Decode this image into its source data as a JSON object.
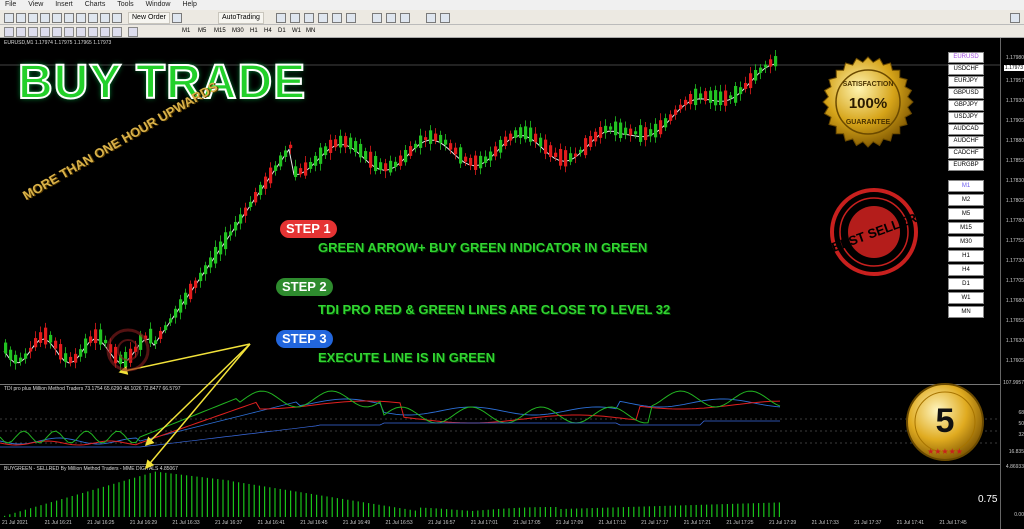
{
  "menu": [
    "File",
    "View",
    "Insert",
    "Charts",
    "Tools",
    "Window",
    "Help"
  ],
  "toolbar": {
    "new_order": "New Order",
    "autotrading": "AutoTrading"
  },
  "timeframes": [
    "M1",
    "M5",
    "M15",
    "M30",
    "H1",
    "H4",
    "D1",
    "W1",
    "MN"
  ],
  "chart": {
    "title": "EURUSD,M1  1.17974 1.17975 1.17965 1.17973",
    "price_labels": [
      "1.17980",
      "1.17973",
      "1.17957",
      "1.17930",
      "1.17905",
      "1.17880",
      "1.17855",
      "1.17830",
      "1.17805",
      "1.17780",
      "1.17755",
      "1.17730",
      "1.17705",
      "1.17680",
      "1.17655",
      "1.17630",
      "1.17605"
    ],
    "tdi_title": "TDI pro plus Million Method Traders 73.1754 65.6290 48.1026 72.8477 66.5797",
    "tdi_labels": [
      "107.9957",
      "68",
      "50",
      "32",
      "16.835"
    ],
    "buy_title": "BUYGREEN - SELLRED By Million Method Traders - MME DIGITALS 4.85067",
    "buy_labels": [
      "4.86933",
      "0.00"
    ],
    "time_labels": [
      "21 Jul 2021",
      "21 Jul 16:21",
      "21 Jul 16:25",
      "21 Jul 16:29",
      "21 Jul 16:33",
      "21 Jul 16:37",
      "21 Jul 16:41",
      "21 Jul 16:45",
      "21 Jul 16:49",
      "21 Jul 16:53",
      "21 Jul 16:57",
      "21 Jul 17:01",
      "21 Jul 17:05",
      "21 Jul 17:09",
      "21 Jul 17:13",
      "21 Jul 17:17",
      "21 Jul 17:21",
      "21 Jul 17:25",
      "21 Jul 17:29",
      "21 Jul 17:33",
      "21 Jul 17:37",
      "21 Jul 17:41",
      "21 Jul 17:45"
    ]
  },
  "symbols": [
    "EURUSD",
    "USDCHF",
    "EURJPY",
    "GBPUSD",
    "GBPJPY",
    "USDJPY",
    "AUDCAD",
    "AUDCHF",
    "CADCHF",
    "EURGBP"
  ],
  "tf_buttons": [
    "M1",
    "M2",
    "M5",
    "M15",
    "M30",
    "H1",
    "H4",
    "D1",
    "W1",
    "MN"
  ],
  "overlay": {
    "title": "BUY TRADE",
    "diagonal": "MORE THAN ONE HOUR UPWARDS",
    "steps": [
      {
        "badge": "STEP 1",
        "text": "GREEN ARROW+ BUY GREEN INDICATOR IN GREEN",
        "color": "#e53333"
      },
      {
        "badge": "STEP 2",
        "text": "TDI PRO  RED & GREEN LINES ARE CLOSE TO LEVEL 32",
        "color": "#2e8b2e"
      },
      {
        "badge": "STEP 3",
        "text": "EXECUTE LINE IS IN GREEN",
        "color": "#2266dd"
      }
    ],
    "seal_top": "SATISFACTION",
    "seal_mid": "100%",
    "seal_bottom": "GUARANTEE",
    "stamp": "BEST SELLER",
    "medal": "5",
    "value_right": "0.75"
  }
}
